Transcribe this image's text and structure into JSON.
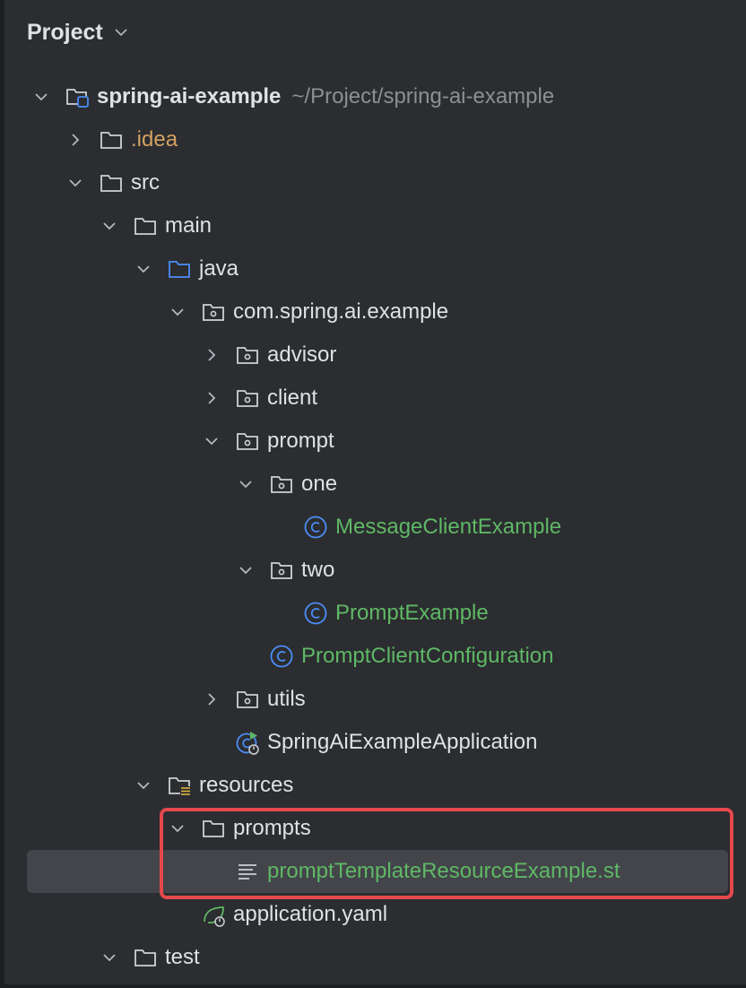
{
  "panel": {
    "title": "Project"
  },
  "tree": {
    "root": {
      "label": "spring-ai-example",
      "path": "~/Project/spring-ai-example"
    },
    "idea": "idea",
    "idea_prefix": ".",
    "src": "src",
    "main": "main",
    "java": "java",
    "package": "com.spring.ai.example",
    "advisor": "advisor",
    "client": "client",
    "prompt": "prompt",
    "one": "one",
    "message_client_example": "MessageClientExample",
    "two": "two",
    "prompt_example": "PromptExample",
    "prompt_client_configuration": "PromptClientConfiguration",
    "utils": "utils",
    "app_class": "SpringAiExampleApplication",
    "resources": "resources",
    "prompts": "prompts",
    "st_file": "promptTemplateResourceExample.st",
    "yaml": "application.yaml",
    "test": "test"
  },
  "colors": {
    "background": "#2b2d30",
    "selection": "#43454a",
    "text": "#dfe1e5",
    "class_green": "#5fb865",
    "idea_orange": "#d4a163",
    "path_gray": "#8c8f94",
    "highlight_red": "#e5484d",
    "source_folder_blue": "#4c8df6"
  }
}
